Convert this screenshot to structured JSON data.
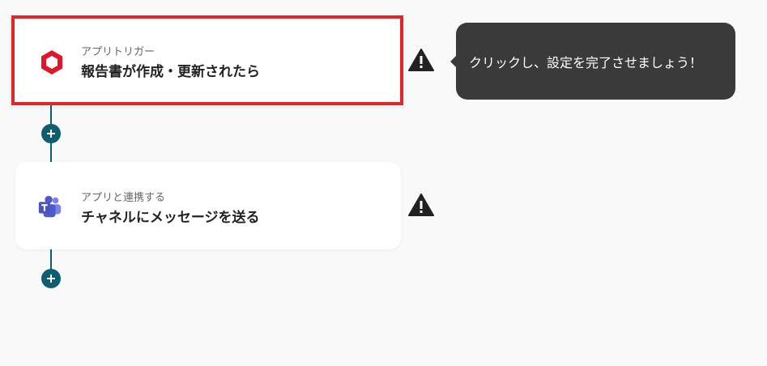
{
  "flow": {
    "steps": [
      {
        "subtitle": "アプリトリガー",
        "title": "報告書が作成・更新されたら",
        "icon": "trigger-hexagon-icon",
        "icon_color": "#e0162b",
        "selected": true
      },
      {
        "subtitle": "アプリと連携する",
        "title": "チャネルにメッセージを送る",
        "icon": "teams-icon",
        "icon_color": "#5059c9",
        "selected": false
      }
    ]
  },
  "tooltip": {
    "text": "クリックし、設定を完了させましょう！"
  },
  "colors": {
    "connector": "#0f5d70",
    "highlight_border": "#e02626",
    "tooltip_bg": "#3a3a3a"
  }
}
